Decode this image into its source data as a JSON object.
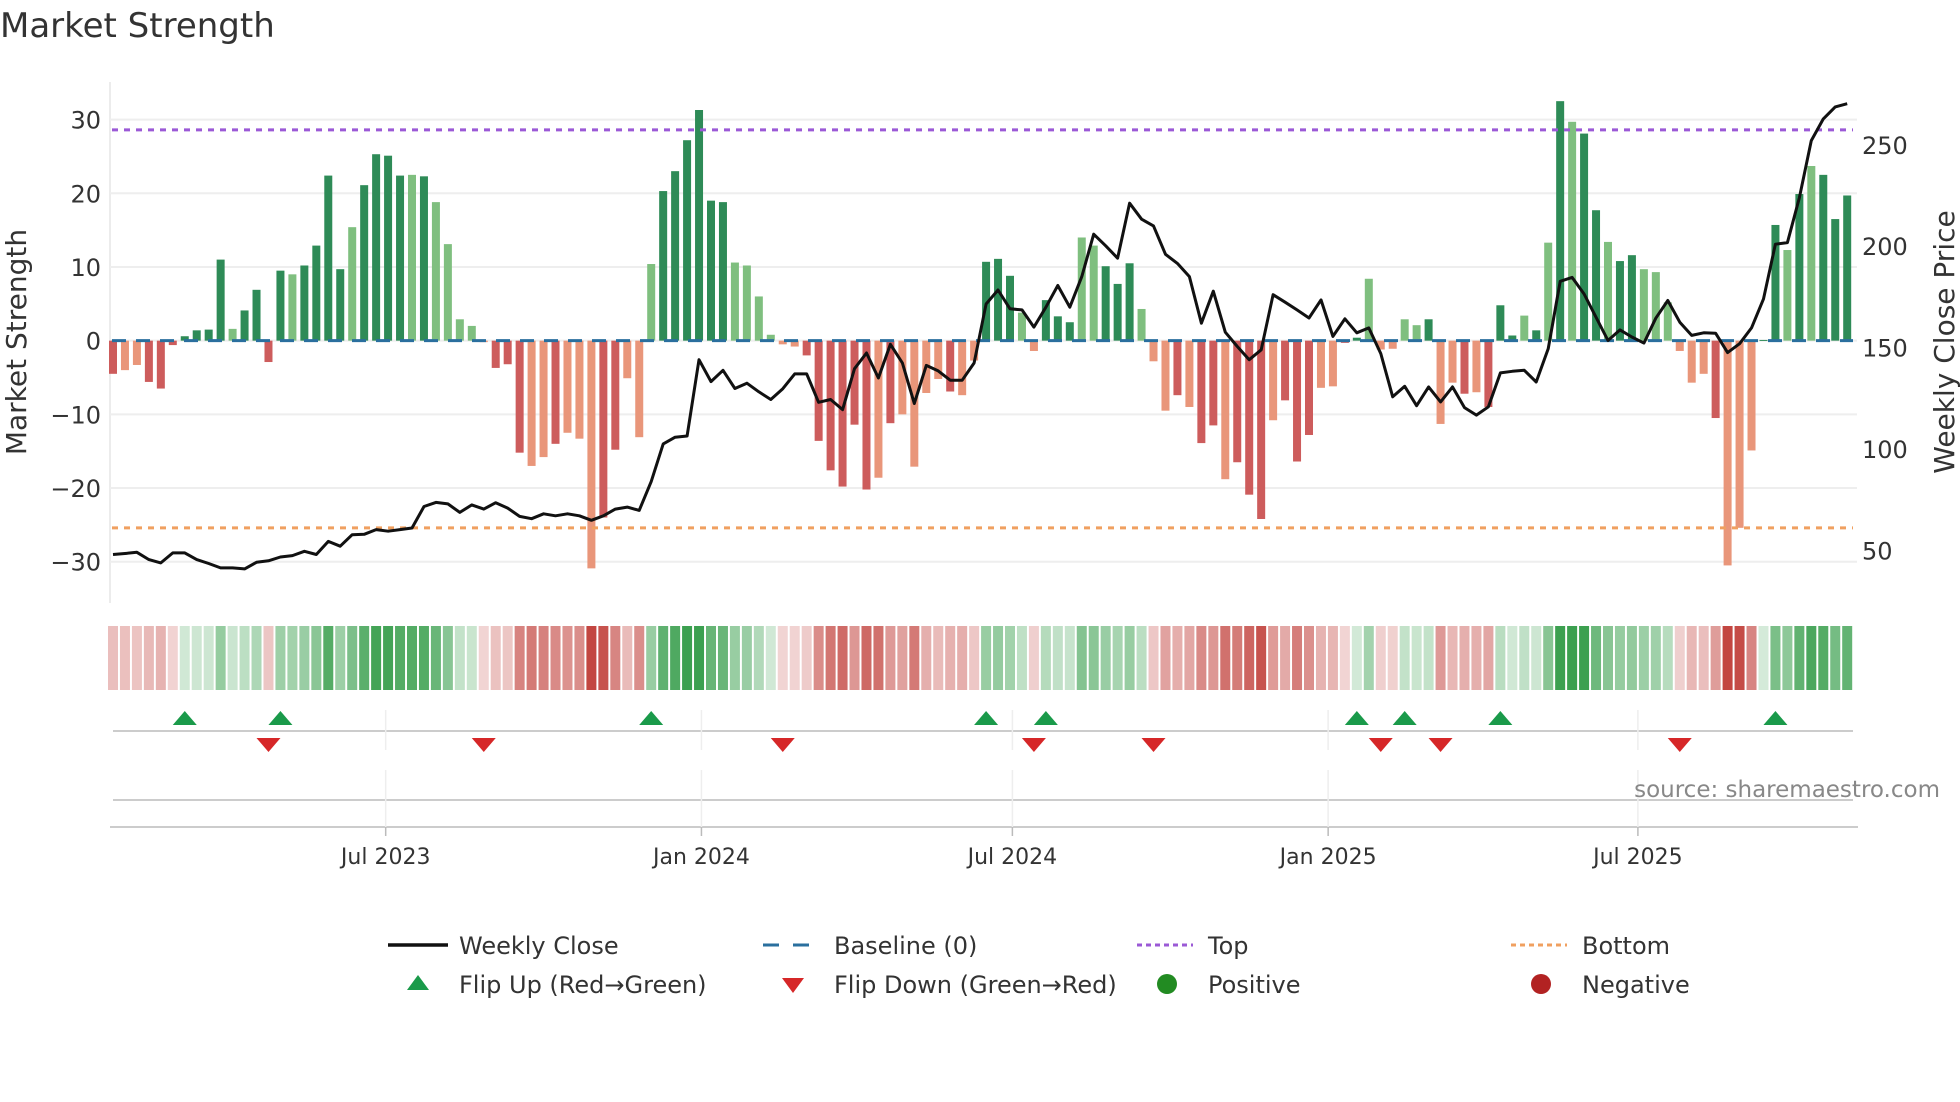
{
  "chart_data": {
    "type": "bar",
    "title": "Market Strength",
    "ylabel": "Market Strength",
    "y2label": "Weekly Close Price",
    "ylim": [
      -35.6,
      35.1
    ],
    "y2lim": [
      24,
      281
    ],
    "yticks": [
      30,
      20,
      10,
      0,
      -10,
      -20,
      -30
    ],
    "y2ticks": [
      250,
      200,
      150,
      100,
      50
    ],
    "top_level": 28.6,
    "bottom_level": -25.4,
    "xticks": [
      {
        "week": 23.8,
        "label": "Jul 2023"
      },
      {
        "week": 50.2,
        "label": "Jan 2024"
      },
      {
        "week": 76.2,
        "label": "Jul 2024"
      },
      {
        "week": 102.6,
        "label": "Jan 2025"
      },
      {
        "week": 128.5,
        "label": "Jul 2025"
      }
    ],
    "strength": [
      -4.5,
      -4.0,
      -3.3,
      -5.6,
      -6.5,
      -0.6,
      0.6,
      1.4,
      1.5,
      11.0,
      1.6,
      4.1,
      6.9,
      -2.9,
      9.5,
      9.0,
      10.2,
      12.9,
      22.4,
      9.7,
      15.4,
      21.1,
      25.3,
      25.1,
      22.4,
      22.5,
      22.3,
      18.8,
      13.1,
      2.9,
      2.0,
      -0.2,
      -3.7,
      -3.2,
      -15.2,
      -17.0,
      -15.8,
      -14.0,
      -12.5,
      -13.3,
      -30.9,
      -24.0,
      -14.8,
      -5.1,
      -13.1,
      10.4,
      20.3,
      23.0,
      27.2,
      31.3,
      19.0,
      18.8,
      10.6,
      10.2,
      6.0,
      0.8,
      -0.5,
      -0.8,
      -2.0,
      -13.6,
      -17.6,
      -19.8,
      -11.4,
      -20.2,
      -18.6,
      -11.2,
      -10.0,
      -17.1,
      -7.1,
      -5.2,
      -6.9,
      -7.4,
      -2.7,
      10.7,
      11.1,
      8.8,
      3.8,
      -1.4,
      5.5,
      3.3,
      2.5,
      14.0,
      12.9,
      10.1,
      7.7,
      10.5,
      4.3,
      -2.8,
      -9.5,
      -7.4,
      -9.0,
      -13.9,
      -11.5,
      -18.8,
      -16.5,
      -20.9,
      -24.2,
      -10.8,
      -8.1,
      -16.4,
      -12.8,
      -6.4,
      -6.2,
      -0.3,
      0.4,
      8.4,
      -1.2,
      -1.1,
      2.9,
      2.1,
      2.9,
      -11.3,
      -5.7,
      -7.2,
      -7.0,
      -9.0,
      4.8,
      0.7,
      3.4,
      1.4,
      13.3,
      32.5,
      29.7,
      28.1,
      17.7,
      13.4,
      10.8,
      11.6,
      9.7,
      9.3,
      5.2,
      -1.4,
      -5.7,
      -4.5,
      -10.5,
      -30.5,
      -25.4,
      -14.9,
      0.1,
      15.7,
      12.3,
      19.9,
      23.7,
      22.5,
      16.5,
      19.7
    ],
    "shade": "dlldddddddlddddlddddlddddldllllldddlldlllddlllddddddllllllddddddldlllldlldddlldddlldddllldlddldddldddllddllllldlldldddldldlddlddlllllldlllddldlddddlddllld",
    "weekly_close": [
      47.9,
      48.4,
      49.0,
      45.4,
      43.8,
      48.7,
      48.7,
      45.4,
      43.5,
      41.3,
      41.3,
      40.8,
      44.1,
      44.8,
      46.7,
      47.4,
      49.5,
      47.9,
      54.4,
      52.0,
      57.7,
      57.9,
      60.2,
      59.4,
      60.2,
      61.0,
      71.6,
      73.6,
      72.9,
      68.7,
      72.4,
      70.3,
      73.5,
      70.8,
      66.7,
      65.6,
      68.0,
      67.0,
      68.0,
      67.0,
      64.8,
      67.0,
      70.3,
      71.3,
      69.7,
      83.9,
      102.5,
      105.8,
      106.4,
      144.0,
      133.2,
      138.8,
      129.8,
      132.4,
      128.2,
      124.4,
      129.7,
      137.0,
      137.0,
      123.0,
      124.4,
      119.4,
      139.6,
      147.3,
      135.0,
      151.6,
      142.4,
      122.4,
      141.2,
      138.5,
      133.9,
      133.9,
      142.4,
      171.5,
      178.4,
      169.1,
      168.6,
      160.1,
      169.9,
      180.6,
      169.9,
      185.0,
      205.9,
      200.2,
      194.1,
      221.2,
      213.3,
      210.0,
      196.0,
      191.5,
      185.0,
      162.0,
      177.8,
      157.6,
      150.6,
      144.0,
      148.9,
      176.1,
      172.4,
      168.6,
      164.6,
      173.5,
      155.5,
      164.2,
      157.3,
      159.7,
      147.0,
      125.7,
      130.9,
      121.3,
      130.6,
      123.2,
      130.6,
      120.4,
      116.7,
      120.8,
      137.5,
      138.3,
      138.8,
      133.0,
      149.4,
      182.7,
      184.6,
      176.4,
      165.0,
      153.5,
      158.7,
      155.2,
      152.2,
      164.5,
      173.2,
      162.5,
      156.0,
      157.3,
      157.1,
      147.5,
      151.9,
      159.7,
      174.0,
      201.0,
      201.8,
      224.0,
      252.1,
      262.8,
      268.7,
      270.3
    ],
    "flip_up_weeks": [
      7,
      15,
      46,
      74,
      79,
      105,
      109,
      117,
      140
    ],
    "flip_down_weeks": [
      14,
      32,
      57,
      78,
      88,
      107,
      112,
      132
    ],
    "legend": {
      "placement": "bottom",
      "items": [
        {
          "key": "close",
          "label": "Weekly Close"
        },
        {
          "key": "baseline",
          "label": "Baseline (0)"
        },
        {
          "key": "top",
          "label": "Top"
        },
        {
          "key": "bottom",
          "label": "Bottom"
        },
        {
          "key": "flipup",
          "label": "Flip Up (Red→Green)"
        },
        {
          "key": "flipdown",
          "label": "Flip Down (Green→Red)"
        },
        {
          "key": "positive",
          "label": "Positive"
        },
        {
          "key": "negative",
          "label": "Negative"
        }
      ]
    },
    "source": "source: sharemaestro.com"
  },
  "colors": {
    "dark_green": "#2e8b57",
    "light_green": "#7fbf7f",
    "dark_red": "#cd5c5c",
    "light_red": "#e9967a",
    "close": "#111111",
    "baseline": "#2a6f9e",
    "top": "#9b59d6",
    "bottom": "#f0a060",
    "flip_up": "#1a9a4a",
    "flip_down": "#d62728",
    "positive": "#228b22",
    "negative": "#b22222"
  }
}
